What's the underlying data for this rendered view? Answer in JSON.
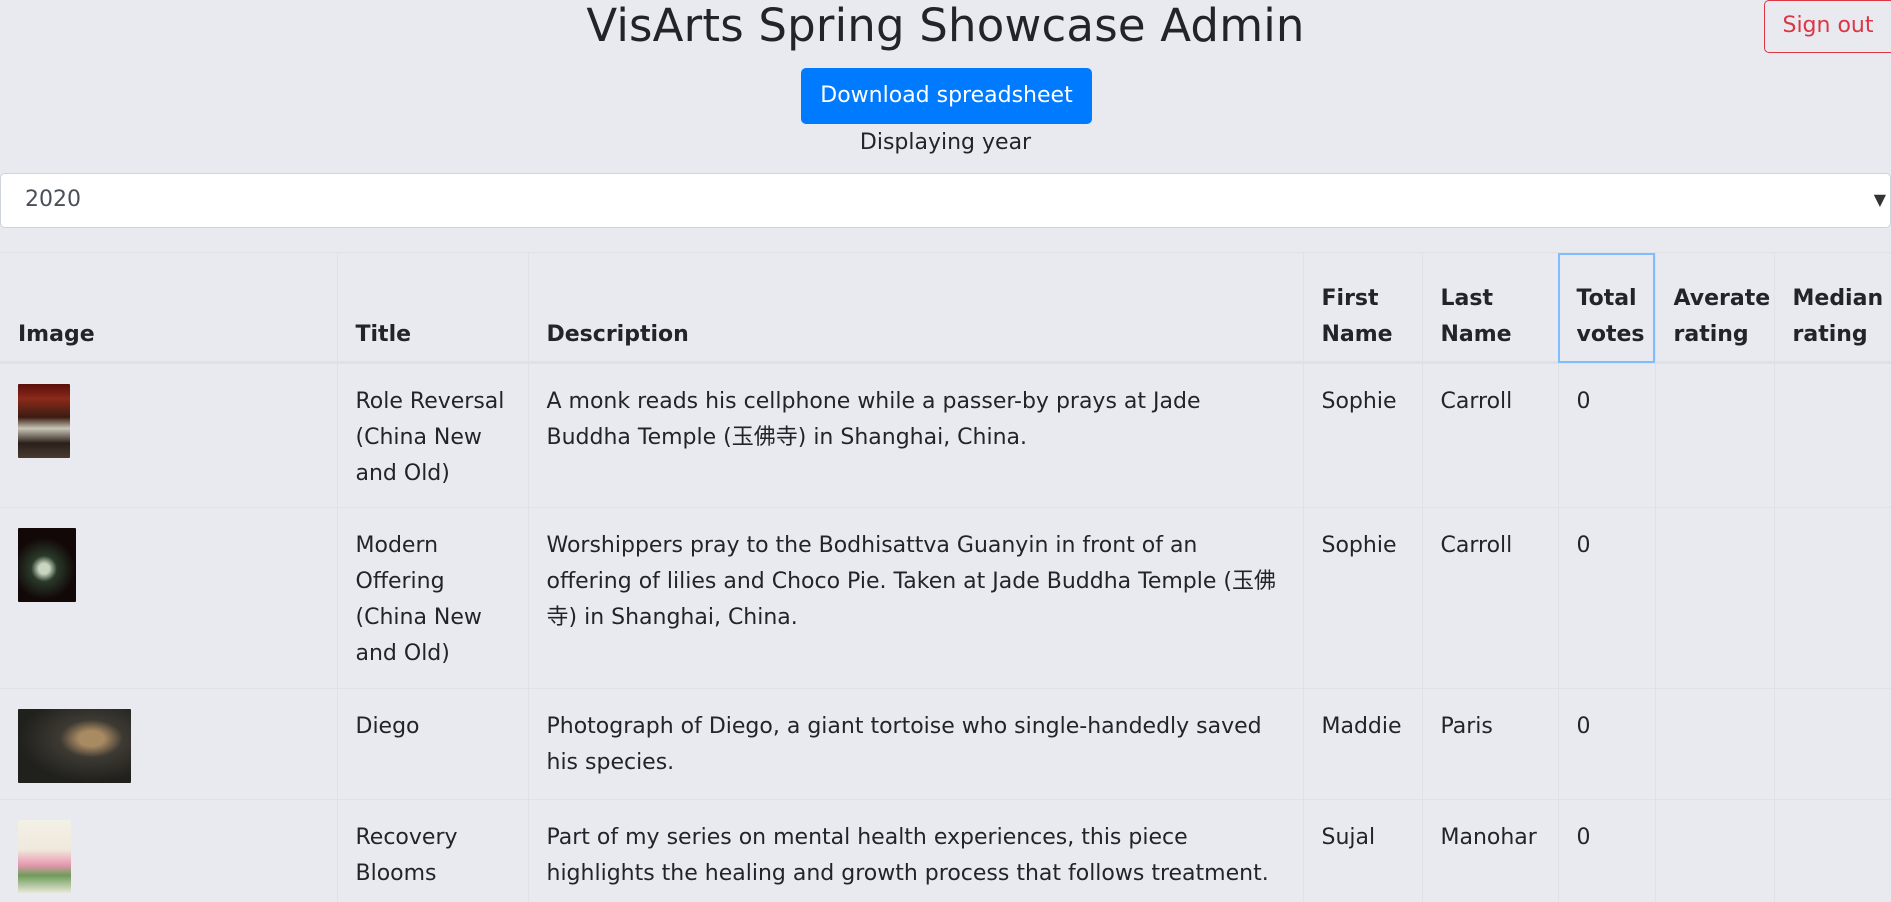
{
  "header": {
    "title": "VisArts Spring Showcase Admin",
    "signout_label": "Sign out",
    "download_label": "Download spreadsheet",
    "display_label": "Displaying year"
  },
  "year_select": {
    "value": "2020"
  },
  "colors": {
    "primary": "#007bff",
    "danger": "#dc3545",
    "background": "#e9eaef"
  },
  "table": {
    "columns": [
      "Image",
      "Title",
      "Description",
      "First Name",
      "Last Name",
      "Total votes",
      "Averate rating",
      "Median rating"
    ],
    "rows": [
      {
        "image": "temple-photo",
        "title": "Role Reversal (China New and Old)",
        "description": "A monk reads his cellphone while a passer-by prays at Jade Buddha Temple (玉佛寺) in Shanghai, China.",
        "first_name": "Sophie",
        "last_name": "Carroll",
        "total_votes": "0",
        "average_rating": "",
        "median_rating": ""
      },
      {
        "image": "offering-photo",
        "title": "Modern Offering (China New and Old)",
        "description": "Worshippers pray to the Bodhisattva Guanyin in front of an offering of lilies and Choco Pie. Taken at Jade Buddha Temple (玉佛寺) in Shanghai, China.",
        "first_name": "Sophie",
        "last_name": "Carroll",
        "total_votes": "0",
        "average_rating": "",
        "median_rating": ""
      },
      {
        "image": "tortoise-photo",
        "title": "Diego",
        "description": "Photograph of Diego, a giant tortoise who single-handedly saved his species.",
        "first_name": "Maddie",
        "last_name": "Paris",
        "total_votes": "0",
        "average_rating": "",
        "median_rating": ""
      },
      {
        "image": "flowers-photo",
        "title": "Recovery Blooms",
        "description": "Part of my series on mental health experiences, this piece highlights the healing and growth process that follows treatment.",
        "first_name": "Sujal",
        "last_name": "Manohar",
        "total_votes": "0",
        "average_rating": "",
        "median_rating": ""
      }
    ]
  }
}
